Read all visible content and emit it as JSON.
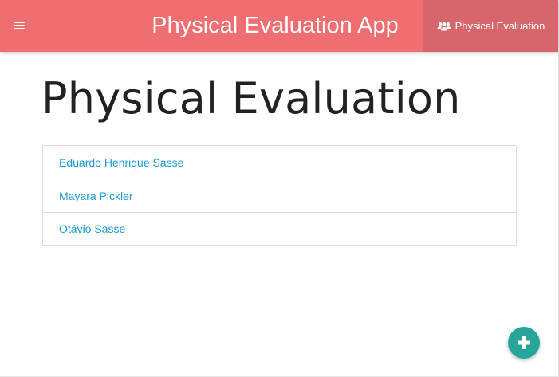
{
  "navbar": {
    "app_title": "Physical Evaluation App",
    "nav_link_label": "Physical Evaluation",
    "menu_icon": "hamburger-menu-icon",
    "nav_link_icon": "users-icon",
    "background_color": "#ef6e71",
    "active_link_color": "#d6666c"
  },
  "main": {
    "page_title": "Physical Evaluation",
    "people": [
      {
        "name": "Eduardo Henrique Sasse"
      },
      {
        "name": "Mayara Pickler"
      },
      {
        "name": "Otávio Sasse"
      }
    ],
    "link_color": "#1a9ad6"
  },
  "fab": {
    "icon": "plus-icon",
    "color": "#27a59a"
  }
}
